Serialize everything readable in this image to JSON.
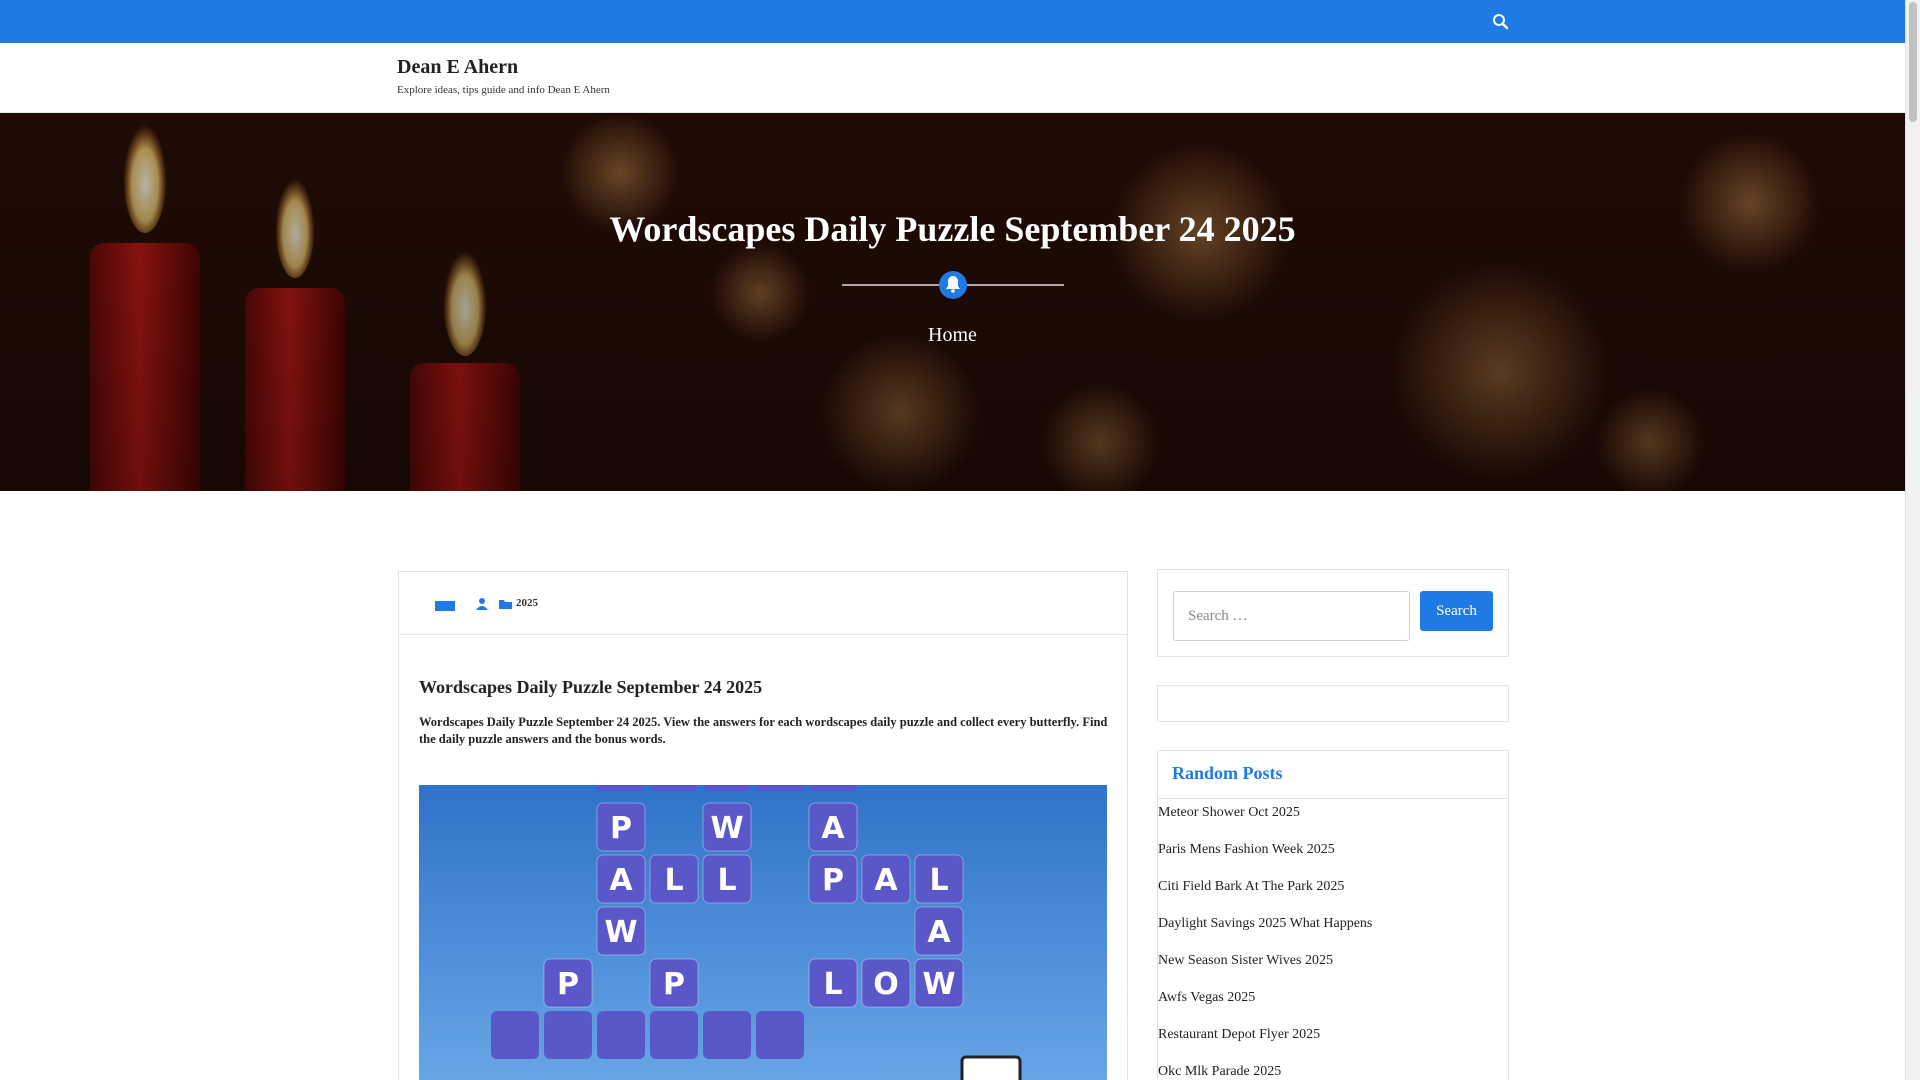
{
  "topbar": {
    "color": "#1f7ae6",
    "search_icon": "search-icon"
  },
  "site": {
    "title": "Dean E Ahern",
    "description": "Explore ideas, tips guide and info Dean E Ahern"
  },
  "hero": {
    "title": "Wordscapes Daily Puzzle September 24 2025",
    "divider_icon": "bell-icon",
    "breadcrumb": "Home"
  },
  "article": {
    "meta": {
      "date_icon": "calendar-icon",
      "author_icon": "user-icon",
      "category_icon": "folder-icon",
      "category": "2025"
    },
    "title": "Wordscapes Daily Puzzle September 24 2025",
    "excerpt": "Wordscapes Daily Puzzle September 24 2025. View the answers for each wordscapes daily puzzle and collect every butterfly. Find the daily puzzle answers and the bonus words.",
    "image": {
      "tiles": [
        "P",
        "W",
        "A",
        "A",
        "L",
        "L",
        "P",
        "A",
        "L",
        "W",
        "A",
        "P",
        "P",
        "L",
        "O",
        "W"
      ]
    }
  },
  "sidebar": {
    "search": {
      "placeholder": "Search …",
      "button": "Search"
    },
    "random_posts": {
      "title": "Random Posts",
      "items": [
        "Meteor Shower Oct 2025",
        "Paris Mens Fashion Week 2025",
        "Citi Field Bark At The Park 2025",
        "Daylight Savings 2025 What Happens",
        "New Season Sister Wives 2025",
        "Awfs Vegas 2025",
        "Restaurant Depot Flyer 2025",
        "Okc Mlk Parade 2025"
      ]
    }
  },
  "colors": {
    "accent": "#1f7ae6",
    "tile": "#5a57c9"
  }
}
